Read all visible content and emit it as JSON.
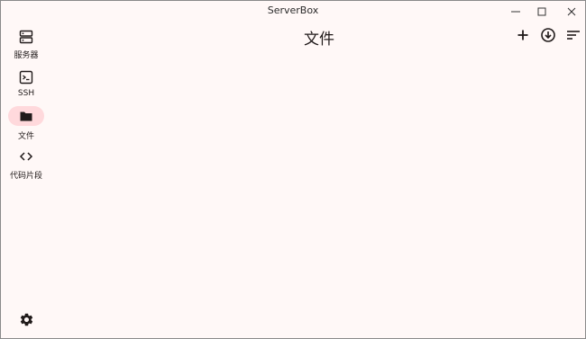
{
  "window": {
    "title": "ServerBox"
  },
  "nav": {
    "items": [
      {
        "label": "服务器",
        "icon": "server-icon",
        "active": false
      },
      {
        "label": "SSH",
        "icon": "terminal-icon",
        "active": false
      },
      {
        "label": "文件",
        "icon": "folder-icon",
        "active": true
      },
      {
        "label": "代码片段",
        "icon": "code-icon",
        "active": false
      }
    ]
  },
  "header": {
    "title": "文件",
    "actions": [
      "add-icon",
      "download-icon",
      "sort-icon"
    ]
  },
  "footer": {
    "settings_icon": "gear-icon"
  },
  "colors": {
    "background": "#FFF8F7",
    "active_indicator": "#FFD9DC",
    "text": "#201A1A"
  }
}
